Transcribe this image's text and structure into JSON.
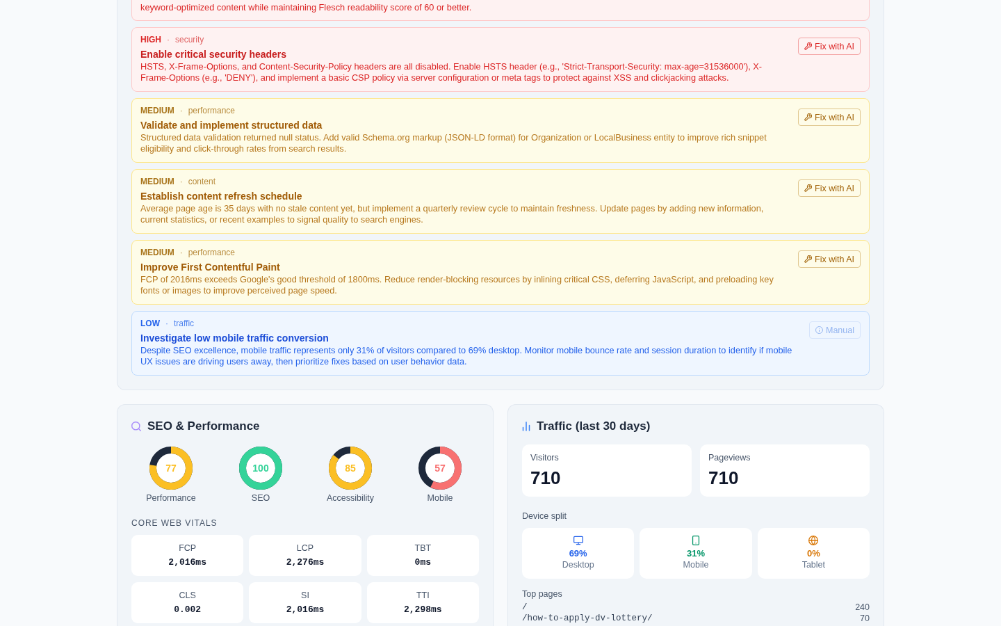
{
  "issues_panel": {
    "issues": [
      {
        "kind": "high",
        "description": "keyword-optimized content while maintaining Flesch readability score of 60 or better."
      },
      {
        "kind": "high",
        "severity": "HIGH",
        "separator": "·",
        "category": "security",
        "title": "Enable critical security headers",
        "description": "HSTS, X-Frame-Options, and Content-Security-Policy headers are all disabled. Enable HSTS header (e.g., 'Strict-Transport-Security: max-age=31536000'), X-Frame-Options (e.g., 'DENY'), and implement a basic CSP policy via server configuration or meta tags to protect against XSS and clickjacking attacks.",
        "action": {
          "kind": "ai",
          "label": "Fix with AI"
        }
      },
      {
        "kind": "medium",
        "severity": "MEDIUM",
        "separator": "·",
        "category": "performance",
        "title": "Validate and implement structured data",
        "description": "Structured data validation returned null status. Add valid Schema.org markup (JSON-LD format) for Organization or LocalBusiness entity to improve rich snippet eligibility and click-through rates from search results.",
        "action": {
          "kind": "ai",
          "label": "Fix with AI"
        }
      },
      {
        "kind": "medium",
        "severity": "MEDIUM",
        "separator": "·",
        "category": "content",
        "title": "Establish content refresh schedule",
        "description": "Average page age is 35 days with no stale content yet, but implement a quarterly review cycle to maintain freshness. Update pages by adding new information, current statistics, or recent examples to signal quality to search engines.",
        "action": {
          "kind": "ai",
          "label": "Fix with AI"
        }
      },
      {
        "kind": "medium",
        "severity": "MEDIUM",
        "separator": "·",
        "category": "performance",
        "title": "Improve First Contentful Paint",
        "description": "FCP of 2016ms exceeds Google's good threshold of 1800ms. Reduce render-blocking resources by inlining critical CSS, deferring JavaScript, and preloading key fonts or images to improve perceived page speed.",
        "action": {
          "kind": "ai",
          "label": "Fix with AI"
        }
      },
      {
        "kind": "low",
        "severity": "LOW",
        "separator": "·",
        "category": "traffic",
        "title": "Investigate low mobile traffic conversion",
        "description": "Despite SEO excellence, mobile traffic represents only 31% of visitors compared to 69% desktop. Monitor mobile bounce rate and session duration to identify if mobile UX issues are driving users away, then prioritize fixes based on user behavior data.",
        "action": {
          "kind": "manual",
          "label": "Manual"
        }
      }
    ]
  },
  "seo_panel": {
    "title": "SEO & Performance",
    "scores": [
      {
        "label": "Performance",
        "score": "77",
        "level": 0.77,
        "color": "#fbbf24"
      },
      {
        "label": "SEO",
        "score": "100",
        "level": 1,
        "color": "#34d399"
      },
      {
        "label": "Accessibility",
        "score": "85",
        "level": 0.85,
        "color": "#fbbf24"
      },
      {
        "label": "Mobile",
        "score": "57",
        "level": 0.57,
        "color": "#f87171"
      }
    ],
    "vitals_title": "CORE WEB VITALS",
    "vitals": [
      {
        "label": "FCP",
        "value": "2,016ms"
      },
      {
        "label": "LCP",
        "value": "2,276ms"
      },
      {
        "label": "TBT",
        "value": "0ms"
      },
      {
        "label": "CLS",
        "value": "0.002"
      },
      {
        "label": "SI",
        "value": "2,016ms"
      },
      {
        "label": "TTI",
        "value": "2,298ms"
      }
    ]
  },
  "traffic_panel": {
    "title": "Traffic (last 30 days)",
    "stats": [
      {
        "label": "Visitors",
        "value": "710"
      },
      {
        "label": "Pageviews",
        "value": "710"
      }
    ],
    "devices_title": "Device split",
    "devices": [
      {
        "kind": "desktop",
        "share": "69%",
        "label": "Desktop",
        "color": "#2563eb"
      },
      {
        "kind": "mobile",
        "share": "31%",
        "label": "Mobile",
        "color": "#059669"
      },
      {
        "kind": "tablet",
        "share": "0%",
        "label": "Tablet",
        "color": "#d97706"
      }
    ],
    "top_pages_title": "Top pages",
    "top_pages": [
      {
        "path": "/",
        "views": "240"
      },
      {
        "path": "/how-to-apply-dv-lottery/",
        "views": "70"
      }
    ]
  }
}
